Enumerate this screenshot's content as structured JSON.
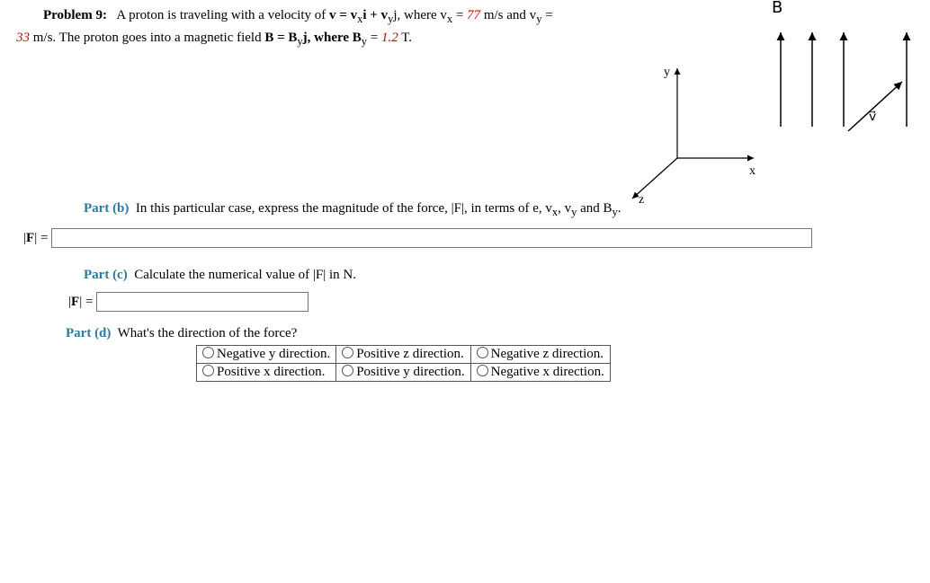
{
  "problem": {
    "number_label": "Problem 9:",
    "text1": "A proton is traveling with a velocity of ",
    "v_eq": "v = v",
    "text1b": "i + v",
    "text1c": "j, where v",
    "text1d": " = ",
    "vx_val": "77",
    "text1e": " m/s and v",
    "text1f": " = ",
    "vy_val": "33",
    "text2": " m/s. The proton goes into a magnetic field ",
    "b_eq1": "B = B",
    "b_eq2": "j, where B",
    "b_eq3": " = ",
    "by_val": "1.2",
    "text3": " T."
  },
  "axes": {
    "y": "y",
    "x": "x",
    "z": "z"
  },
  "field_diag": {
    "B": "B⃗",
    "v": "v⃗"
  },
  "part_b": {
    "label": "Part (b)",
    "text": "In this particular case, express the magnitude of the force, |F|, in terms of e, v",
    "text2": ", v",
    "text3": " and B",
    "text4": ".",
    "lhs": "|F| ="
  },
  "part_c": {
    "label": "Part (c)",
    "text": "Calculate the numerical value of |F| in N.",
    "lhs": "|F| ="
  },
  "part_d": {
    "label": "Part (d)",
    "text": "What's the direction of the force?",
    "options": [
      [
        "Negative y direction.",
        "Positive z direction.",
        "Negative z direction."
      ],
      [
        "Positive x direction.",
        "Positive y direction.",
        "Negative x direction."
      ]
    ]
  }
}
